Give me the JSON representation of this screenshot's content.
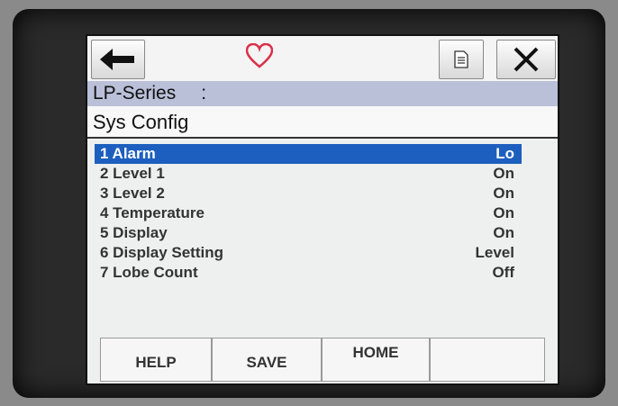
{
  "toolbar": {
    "back_icon": "back-arrow-icon",
    "favorite_icon": "heart-icon",
    "document_icon": "document-icon",
    "close_icon": "close-icon"
  },
  "header": {
    "title": "LP-Series",
    "separator": ":",
    "subtitle": "Sys Config"
  },
  "menu": {
    "items": [
      {
        "label": "1 Alarm",
        "value": "Lo"
      },
      {
        "label": "2 Level 1",
        "value": "On"
      },
      {
        "label": "3 Level 2",
        "value": "On"
      },
      {
        "label": "4 Temperature",
        "value": "On"
      },
      {
        "label": "5 Display",
        "value": "On"
      },
      {
        "label": "6 Display Setting",
        "value": "Level"
      },
      {
        "label": "7 Lobe Count",
        "value": "Off"
      }
    ]
  },
  "footer": {
    "help": "HELP",
    "save": "SAVE",
    "home": "HOME",
    "blank": ""
  },
  "colors": {
    "selection": "#1d5fbf",
    "title_bar": "#b9c0d8",
    "heart": "#d9304a"
  }
}
